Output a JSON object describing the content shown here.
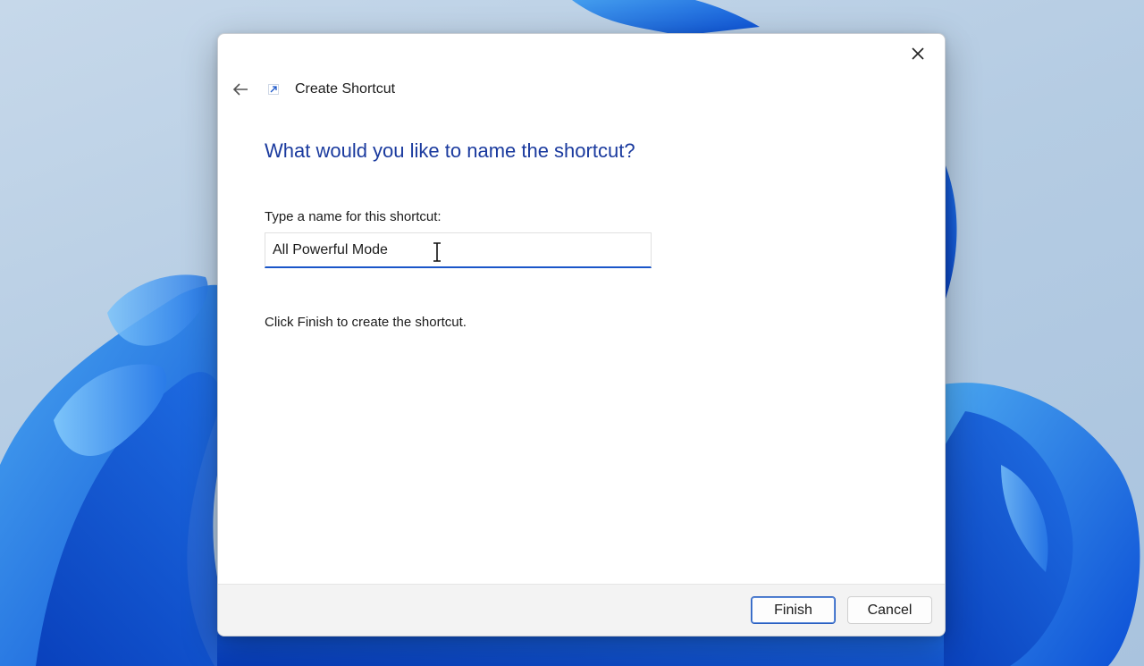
{
  "dialog": {
    "title": "Create Shortcut",
    "question": "What would you like to name the shortcut?",
    "field_label": "Type a name for this shortcut:",
    "name_value": "All Powerful Mode",
    "instruction": "Click Finish to create the shortcut.",
    "icons": {
      "close": "close-icon",
      "back": "back-arrow-icon",
      "shortcut": "shortcut-arrow-icon",
      "cursor": "text-cursor-icon"
    }
  },
  "footer": {
    "finish_label": "Finish",
    "cancel_label": "Cancel"
  },
  "colors": {
    "heading": "#1a3a9e",
    "accent": "#1a56c9"
  }
}
